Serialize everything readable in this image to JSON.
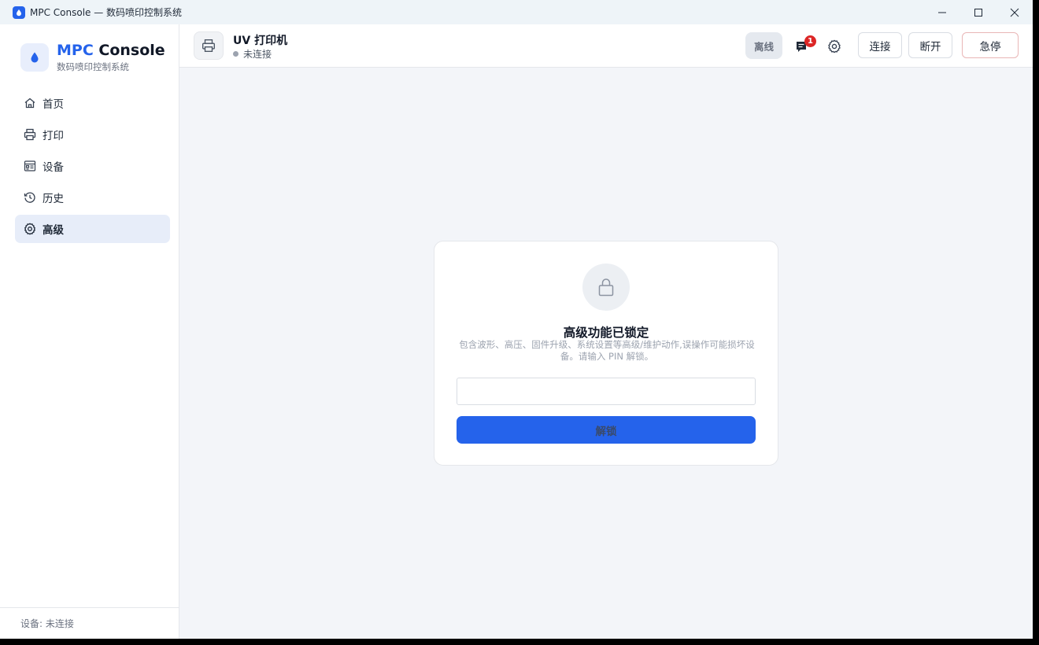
{
  "window": {
    "title": "MPC Console — 数码喷印控制系统",
    "controls": [
      "minimize",
      "maximize",
      "close"
    ]
  },
  "sidebar": {
    "brand_accent": "MPC",
    "brand_rest": " Console",
    "brand_subtitle": "数码喷印控制系统",
    "items": [
      {
        "label": "首页",
        "icon": "home-icon",
        "active": false
      },
      {
        "label": "打印",
        "icon": "printer-icon",
        "active": false
      },
      {
        "label": "设备",
        "icon": "device-icon",
        "active": false
      },
      {
        "label": "历史",
        "icon": "history-icon",
        "active": false
      },
      {
        "label": "高级",
        "icon": "gear-icon",
        "active": true
      }
    ],
    "footer": "设备: 未连接"
  },
  "header": {
    "device_name": "UV 打印机",
    "device_status": "未连接",
    "badge": "离线",
    "notification_count": "1",
    "buttons": {
      "connect": "连接",
      "disconnect": "断开",
      "estop": "急停"
    }
  },
  "lock_card": {
    "title": "高级功能已锁定",
    "description": "包含波形、高压、固件升级、系统设置等高级/维护动作,误操作可能损坏设备。请输入 PIN 解锁。",
    "pin_value": "",
    "pin_placeholder": "",
    "unlock_label": "解锁"
  },
  "colors": {
    "accent": "#2563eb",
    "active_nav_bg": "#e7edf9",
    "badge_red": "#dc2626",
    "estop_border": "#e9b6b6"
  }
}
